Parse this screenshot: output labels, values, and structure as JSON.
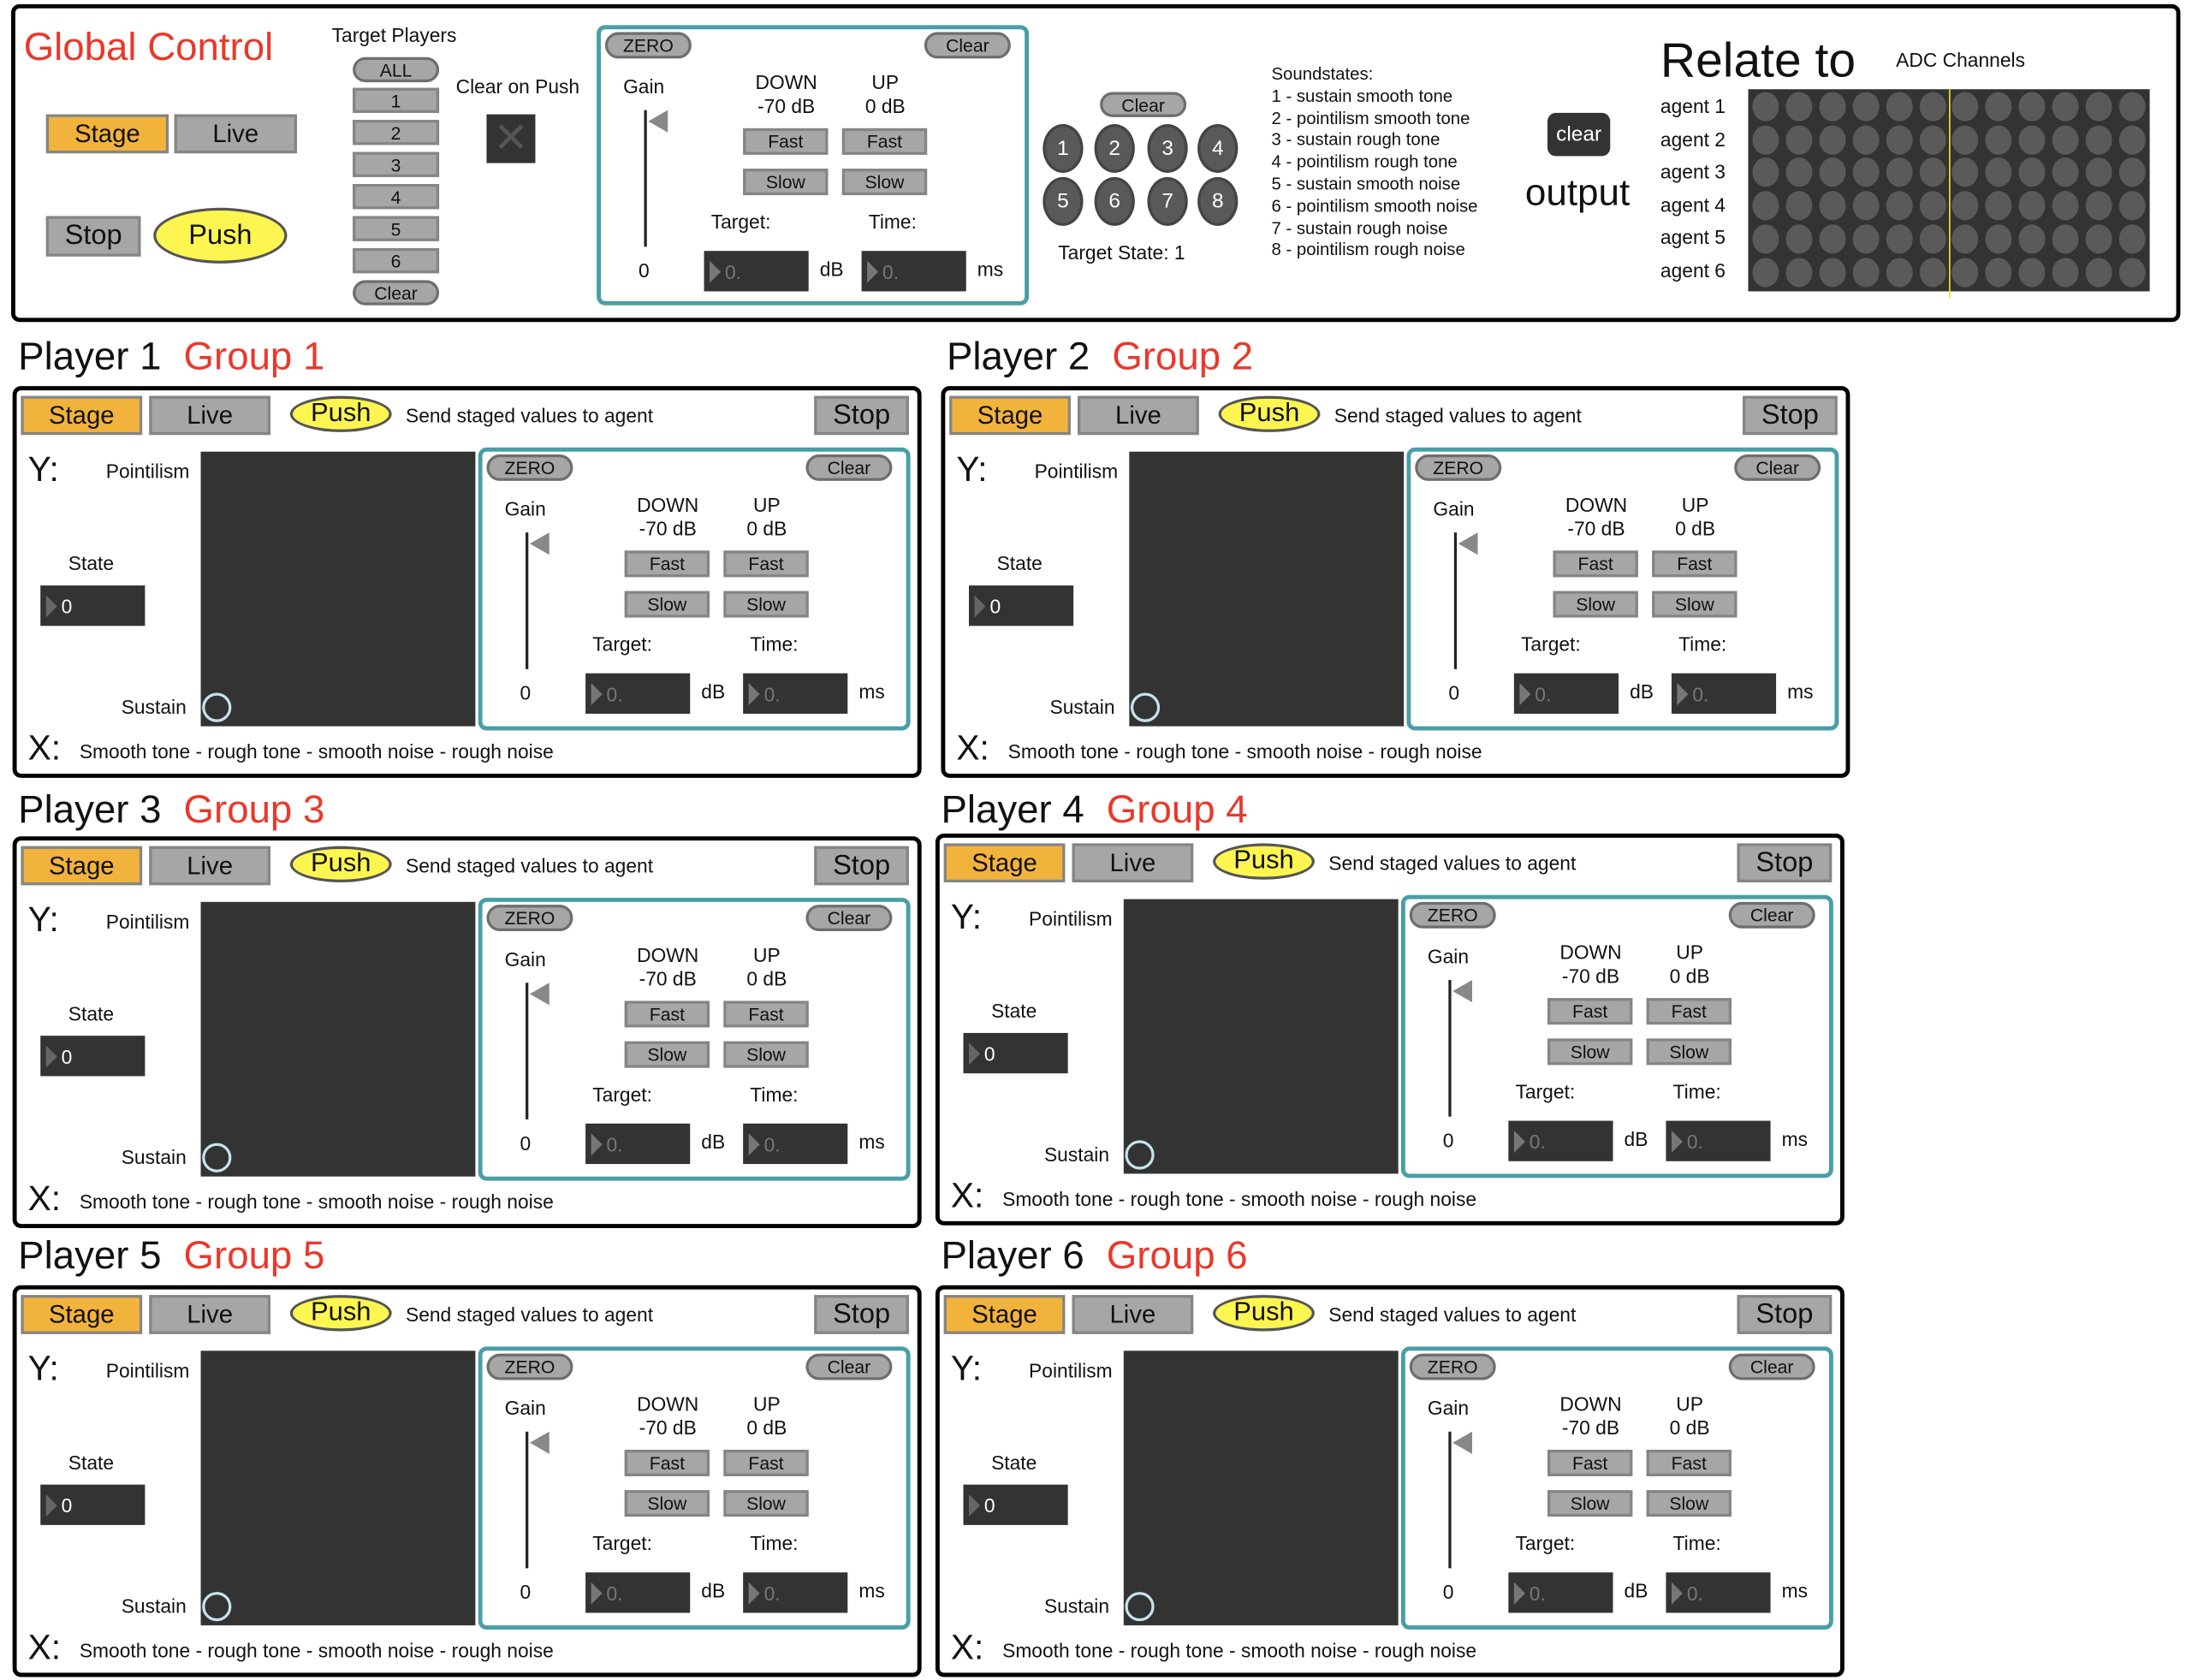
{
  "global": {
    "title": "Global Control",
    "stage": "Stage",
    "live": "Live",
    "stop": "Stop",
    "push": "Push",
    "target_players_label": "Target Players",
    "target_buttons": [
      "ALL",
      "1",
      "2",
      "3",
      "4",
      "5",
      "6"
    ],
    "target_clear": "Clear",
    "clear_on_push_label": "Clear on Push",
    "clear_on_push_checked": false
  },
  "gain_panel": {
    "zero": "ZERO",
    "clear": "Clear",
    "gain_label": "Gain",
    "gain_value": "0",
    "down_label": "DOWN",
    "down_value": "-70 dB",
    "up_label": "UP",
    "up_value": "0 dB",
    "fast": "Fast",
    "slow": "Slow",
    "target_label": "Target:",
    "target_value": "0.",
    "target_unit": "dB",
    "time_label": "Time:",
    "time_value": "0.",
    "time_unit": "ms"
  },
  "state_select": {
    "clear": "Clear",
    "buttons": [
      "1",
      "2",
      "3",
      "4",
      "5",
      "6",
      "7",
      "8"
    ],
    "target_state": "Target State: 1"
  },
  "soundstates": {
    "title": "Soundstates:",
    "items": [
      "1 - sustain smooth tone",
      "2 - pointilism smooth tone",
      "3 - sustain rough tone",
      "4 - pointilism rough tone",
      "5 - sustain smooth noise",
      "6 - pointilism smooth noise",
      "7 - sustain rough noise",
      "8 - pointilism rough noise"
    ]
  },
  "output": {
    "clear": "clear",
    "label": "output"
  },
  "relate": {
    "title": "Relate to",
    "subtitle": "ADC Channels",
    "agents": [
      "agent 1",
      "agent 2",
      "agent 3",
      "agent 4",
      "agent 5",
      "agent 6"
    ],
    "channels": 12,
    "marker_color": "#f5e61a"
  },
  "player_common": {
    "stage": "Stage",
    "live": "Live",
    "push": "Push",
    "push_hint": "Send staged values to agent",
    "stop": "Stop",
    "y_axis": "Y:",
    "y_top": "Pointilism",
    "y_bottom": "Sustain",
    "state_label": "State",
    "x_axis": "X:",
    "x_desc": "Smooth tone - rough tone - smooth noise - rough noise"
  },
  "players": [
    {
      "name": "Player 1",
      "group": "Group 1",
      "state": "0"
    },
    {
      "name": "Player 2",
      "group": "Group 2",
      "state": "0"
    },
    {
      "name": "Player 3",
      "group": "Group 3",
      "state": "0"
    },
    {
      "name": "Player 4",
      "group": "Group 4",
      "state": "0"
    },
    {
      "name": "Player 5",
      "group": "Group 5",
      "state": "0"
    },
    {
      "name": "Player 6",
      "group": "Group 6",
      "state": "0"
    }
  ],
  "colors": {
    "stage": "#f2b33d",
    "push": "#fdf651",
    "accent_red": "#e8392b",
    "panel_border": "#4a9ea5"
  }
}
